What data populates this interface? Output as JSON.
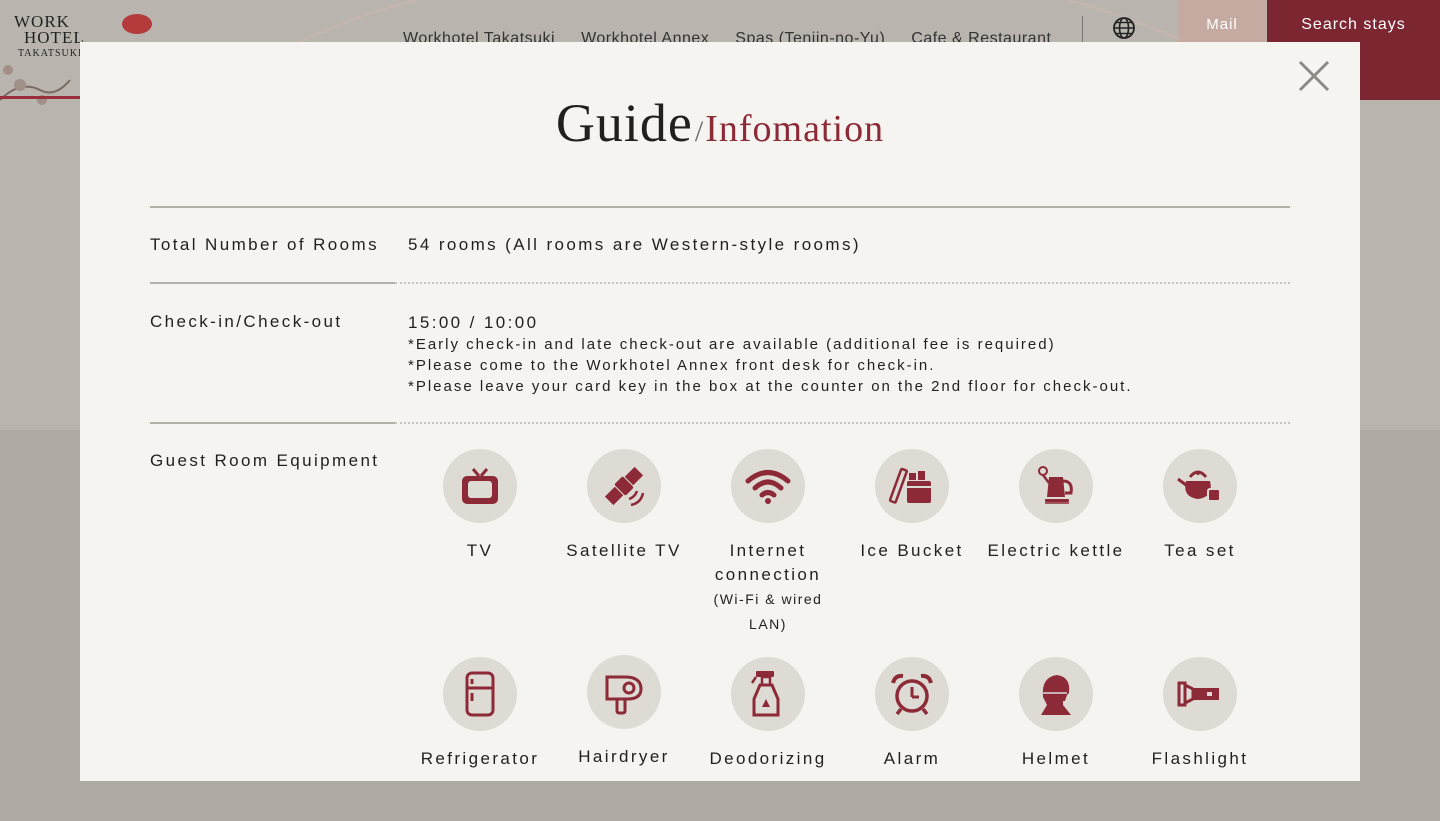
{
  "site": {
    "logo_line1": "WORK",
    "logo_line2": "HOTEL",
    "logo_line3": "TAKATSUKI",
    "nav": [
      "Workhotel Takatsuki",
      "Workhotel Annex",
      "Spas (Tenjin-no-Yu)",
      "Cafe & Restaurant"
    ],
    "mail_label": "Mail",
    "search_label": "Search stays"
  },
  "modal": {
    "title_main": "Guide",
    "title_slash": "/",
    "title_sub": "Infomation",
    "rows": {
      "rooms": {
        "label": "Total Number of Rooms",
        "value": "54 rooms (All rooms are Western-style rooms)"
      },
      "checkin": {
        "label": "Check-in/Check-out",
        "value": "15:00 / 10:00",
        "notes": [
          "*Early check-in and late check-out are available (additional fee is required)",
          "*Please come to the Workhotel Annex front desk for check-in.",
          "*Please leave your card key in the box at the counter on the 2nd floor for check-out."
        ]
      },
      "equipment": {
        "label": "Guest Room Equipment",
        "items": [
          {
            "name": "TV",
            "icon": "tv-icon"
          },
          {
            "name": "Satellite TV",
            "icon": "satellite-icon"
          },
          {
            "name": "Internet connection",
            "sub": "(Wi-Fi & wired LAN)",
            "icon": "wifi-icon"
          },
          {
            "name": "Ice Bucket",
            "icon": "ice-bucket-icon"
          },
          {
            "name": "Electric kettle",
            "icon": "kettle-icon"
          },
          {
            "name": "Tea set",
            "icon": "teapot-icon"
          },
          {
            "name": "Refrigerator",
            "icon": "refrigerator-icon"
          },
          {
            "name": "Hairdryer",
            "icon": "hairdryer-icon"
          },
          {
            "name": "Deodorizing",
            "icon": "spray-bottle-icon"
          },
          {
            "name": "Alarm",
            "icon": "alarm-clock-icon"
          },
          {
            "name": "Helmet",
            "icon": "helmet-icon"
          },
          {
            "name": "Flashlight",
            "icon": "flashlight-icon"
          }
        ]
      }
    }
  },
  "colors": {
    "accent": "#8d2a38",
    "icon_bg": "#dedbd5",
    "modal_bg": "#f5f4f0",
    "search_btn": "#7c2632"
  }
}
